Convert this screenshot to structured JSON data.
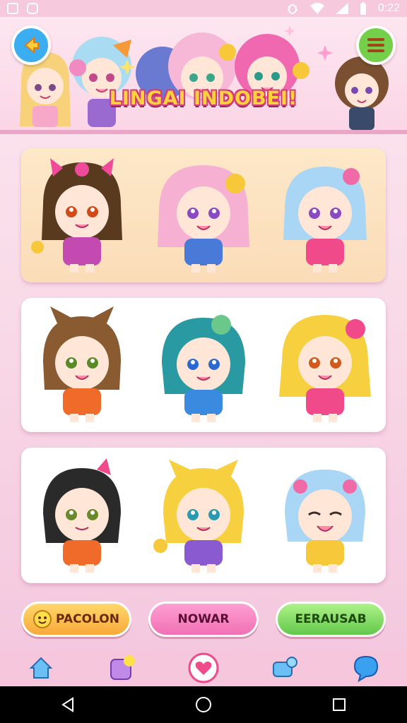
{
  "status_bar": {
    "time": "0:22",
    "icons": [
      "image-icon",
      "app-icon",
      "bug-icon",
      "wifi-icon",
      "signal-icon",
      "battery-icon"
    ]
  },
  "header": {
    "title": "LINGAI INDOBEI!",
    "back_icon": "arrow-left-icon",
    "menu_icon": "hamburger-menu-icon",
    "colors": {
      "back": "#3aaef0",
      "menu": "#74d04a",
      "title": "#ffd23c"
    }
  },
  "sticker_rows": [
    {
      "name": "row-1",
      "stickers": [
        "brunette-bow-girl",
        "pink-hair-girl",
        "blue-hair-girl"
      ]
    },
    {
      "name": "row-2",
      "stickers": [
        "brown-cat-ear-girl",
        "teal-hair-girl",
        "blonde-bow-girl"
      ]
    },
    {
      "name": "row-3",
      "stickers": [
        "black-hair-girl",
        "blonde-cat-ear-girl",
        "light-blue-hair-girl"
      ]
    }
  ],
  "actions": {
    "left_label": "PACOLON",
    "center_label": "NOWAR",
    "right_label": "EERAUSAB"
  },
  "bottom_nav": {
    "items": [
      "home-icon",
      "sticker-icon",
      "heart-icon",
      "message-icon",
      "chat-bubble-icon"
    ]
  },
  "system_nav": {
    "items": [
      "back-triangle-icon",
      "home-circle-icon",
      "recents-square-icon"
    ]
  }
}
